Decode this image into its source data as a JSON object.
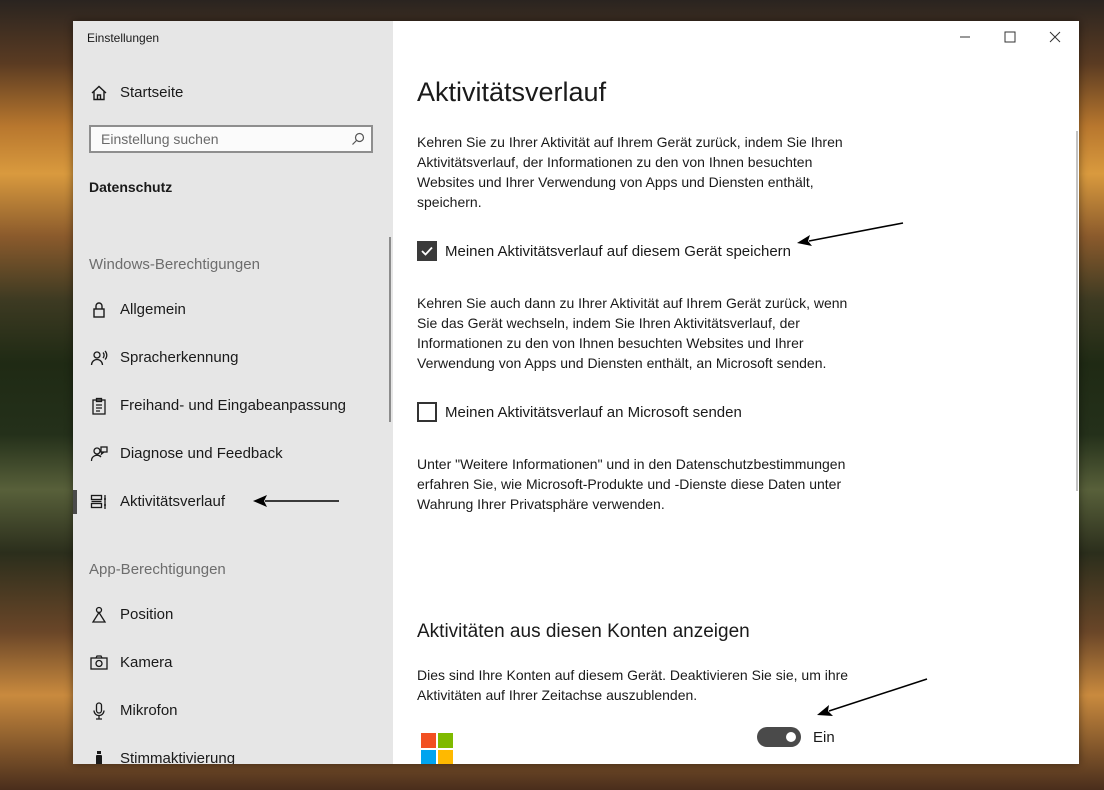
{
  "window": {
    "title": "Einstellungen",
    "controls": {
      "minimize": "minimize-icon",
      "maximize": "maximize-icon",
      "close": "close-icon"
    }
  },
  "sidebar": {
    "home_label": "Startseite",
    "search_placeholder": "Einstellung suchen",
    "category": "Datenschutz",
    "group1": {
      "heading": "Windows-Berechtigungen",
      "items": [
        {
          "label": "Allgemein",
          "icon": "lock-icon"
        },
        {
          "label": "Spracherkennung",
          "icon": "speech-icon"
        },
        {
          "label": "Freihand- und Eingabeanpassung",
          "icon": "clipboard-icon"
        },
        {
          "label": "Diagnose und Feedback",
          "icon": "feedback-icon"
        },
        {
          "label": "Aktivitätsverlauf",
          "icon": "activity-history-icon",
          "active": true
        }
      ]
    },
    "group2": {
      "heading": "App-Berechtigungen",
      "items": [
        {
          "label": "Position",
          "icon": "location-icon"
        },
        {
          "label": "Kamera",
          "icon": "camera-icon"
        },
        {
          "label": "Mikrofon",
          "icon": "microphone-icon"
        },
        {
          "label": "Stimmaktivierung",
          "icon": "voice-activation-icon"
        }
      ]
    }
  },
  "main": {
    "title": "Aktivitätsverlauf",
    "intro": "Kehren Sie zu Ihrer Aktivität auf Ihrem Gerät zurück, indem Sie Ihren Aktivitätsverlauf, der Informationen zu den von Ihnen besuchten Websites und Ihrer Verwendung von Apps und Diensten enthält, speichern.",
    "checkbox_store": {
      "label": "Meinen Aktivitätsverlauf auf diesem Gerät speichern",
      "checked": true
    },
    "para2": "Kehren Sie auch dann zu Ihrer Aktivität auf Ihrem Gerät zurück, wenn Sie das Gerät wechseln, indem Sie Ihren Aktivitätsverlauf, der Informationen zu den von Ihnen besuchten Websites und Ihrer Verwendung von Apps und Diensten enthält, an Microsoft senden.",
    "checkbox_send": {
      "label": "Meinen Aktivitätsverlauf an Microsoft senden",
      "checked": false
    },
    "para3": "Unter \"Weitere Informationen\" und in den Datenschutzbestimmungen erfahren Sie, wie Microsoft-Produkte und -Dienste diese Daten unter Wahrung Ihrer Privatsphäre verwenden.",
    "accounts_heading": "Aktivitäten aus diesen Konten anzeigen",
    "accounts_desc": "Dies sind Ihre Konten auf diesem Gerät. Deaktivieren Sie sie, um ihre Aktivitäten auf Ihrer Zeitachse auszublenden.",
    "account_toggle": {
      "state_label": "Ein",
      "on": true
    }
  },
  "colors": {
    "sidebar_bg": "#e6e6e6",
    "active_indicator": "#4a4a4a",
    "checkbox_checked": "#3a3a3a",
    "toggle_on": "#4a4a4a",
    "ms_red": "#f25022",
    "ms_green": "#7fba00",
    "ms_blue": "#00a4ef",
    "ms_yellow": "#ffb900"
  }
}
